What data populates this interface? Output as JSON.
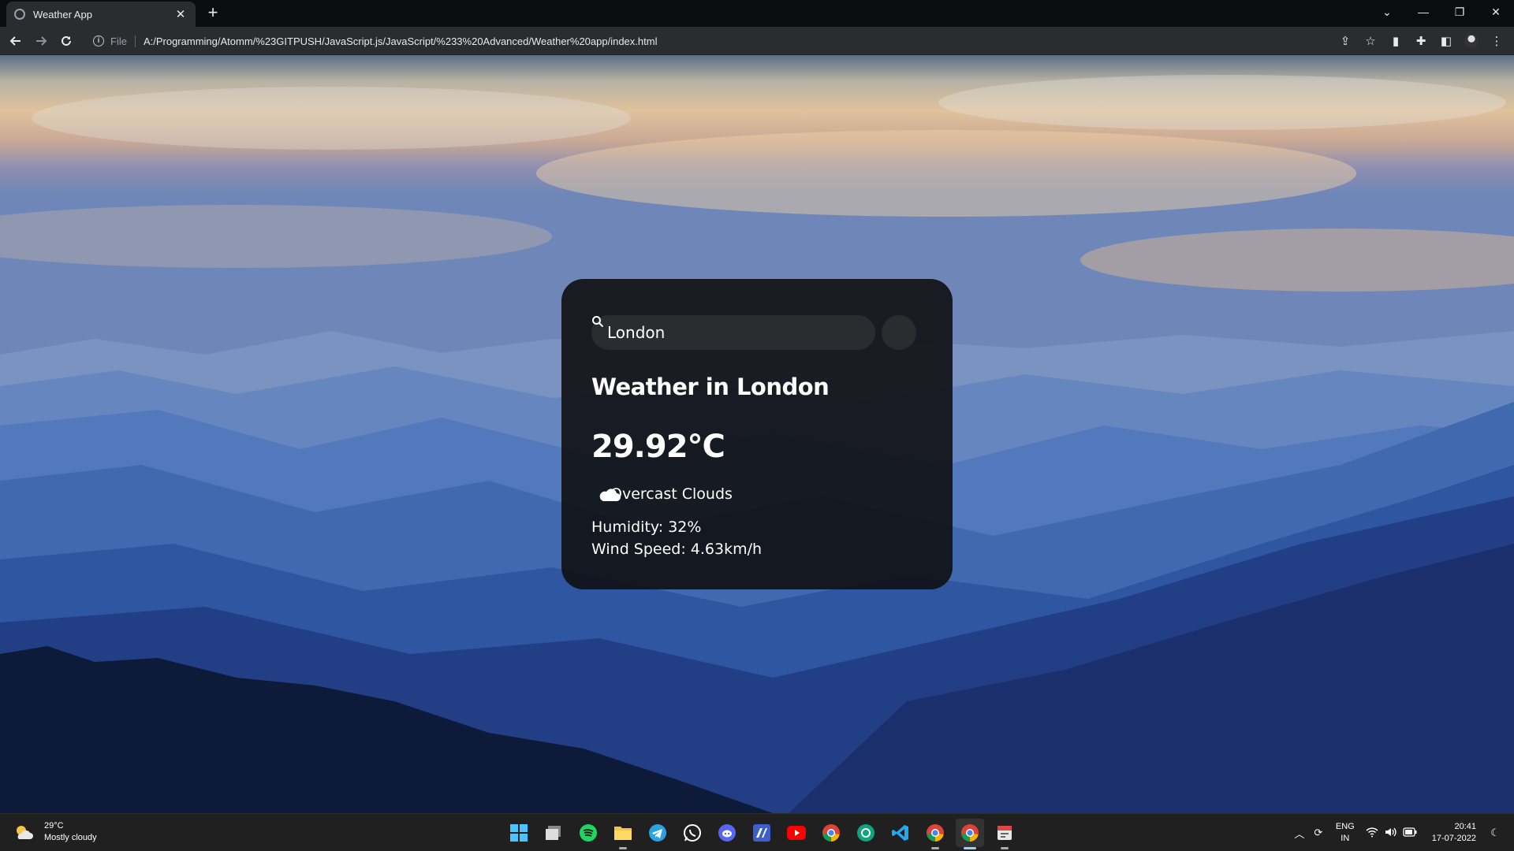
{
  "browser": {
    "tab_title": "Weather App",
    "tab_close": "✕",
    "new_tab": "+",
    "scheme_label": "File",
    "url": "A:/Programming/Atomm/%23GITPUSH/JavaScript.js/JavaScript/%233%20Advanced/Weather%20app/index.html",
    "window_controls": {
      "list": "⌄",
      "minimize": "—",
      "restore": "❐",
      "close": "✕"
    }
  },
  "weather_card": {
    "search_value": "London",
    "heading": "Weather in London",
    "temperature": "29.92°C",
    "description": "Overcast Clouds",
    "humidity": "Humidity: 32%",
    "wind": "Wind Speed: 4.63km/h"
  },
  "taskbar": {
    "widget_temp": "29°C",
    "widget_condition": "Mostly cloudy",
    "apps": [
      "start-icon",
      "task-view-icon",
      "spotify-icon",
      "file-explorer-icon",
      "telegram-icon",
      "whatsapp-icon",
      "discord-icon",
      "editor-icon",
      "youtube-icon",
      "chrome-icon",
      "chatgpt-icon",
      "vscode-icon",
      "chrome-dev-icon",
      "chrome-active-icon",
      "snipping-icon"
    ],
    "lang_top": "ENG",
    "lang_bottom": "IN",
    "time": "20:41",
    "date": "17-07-2022"
  },
  "colors": {
    "card_bg": "#0f1012",
    "chrome_bg": "#2b2c30",
    "taskbar_bg": "#202020"
  }
}
